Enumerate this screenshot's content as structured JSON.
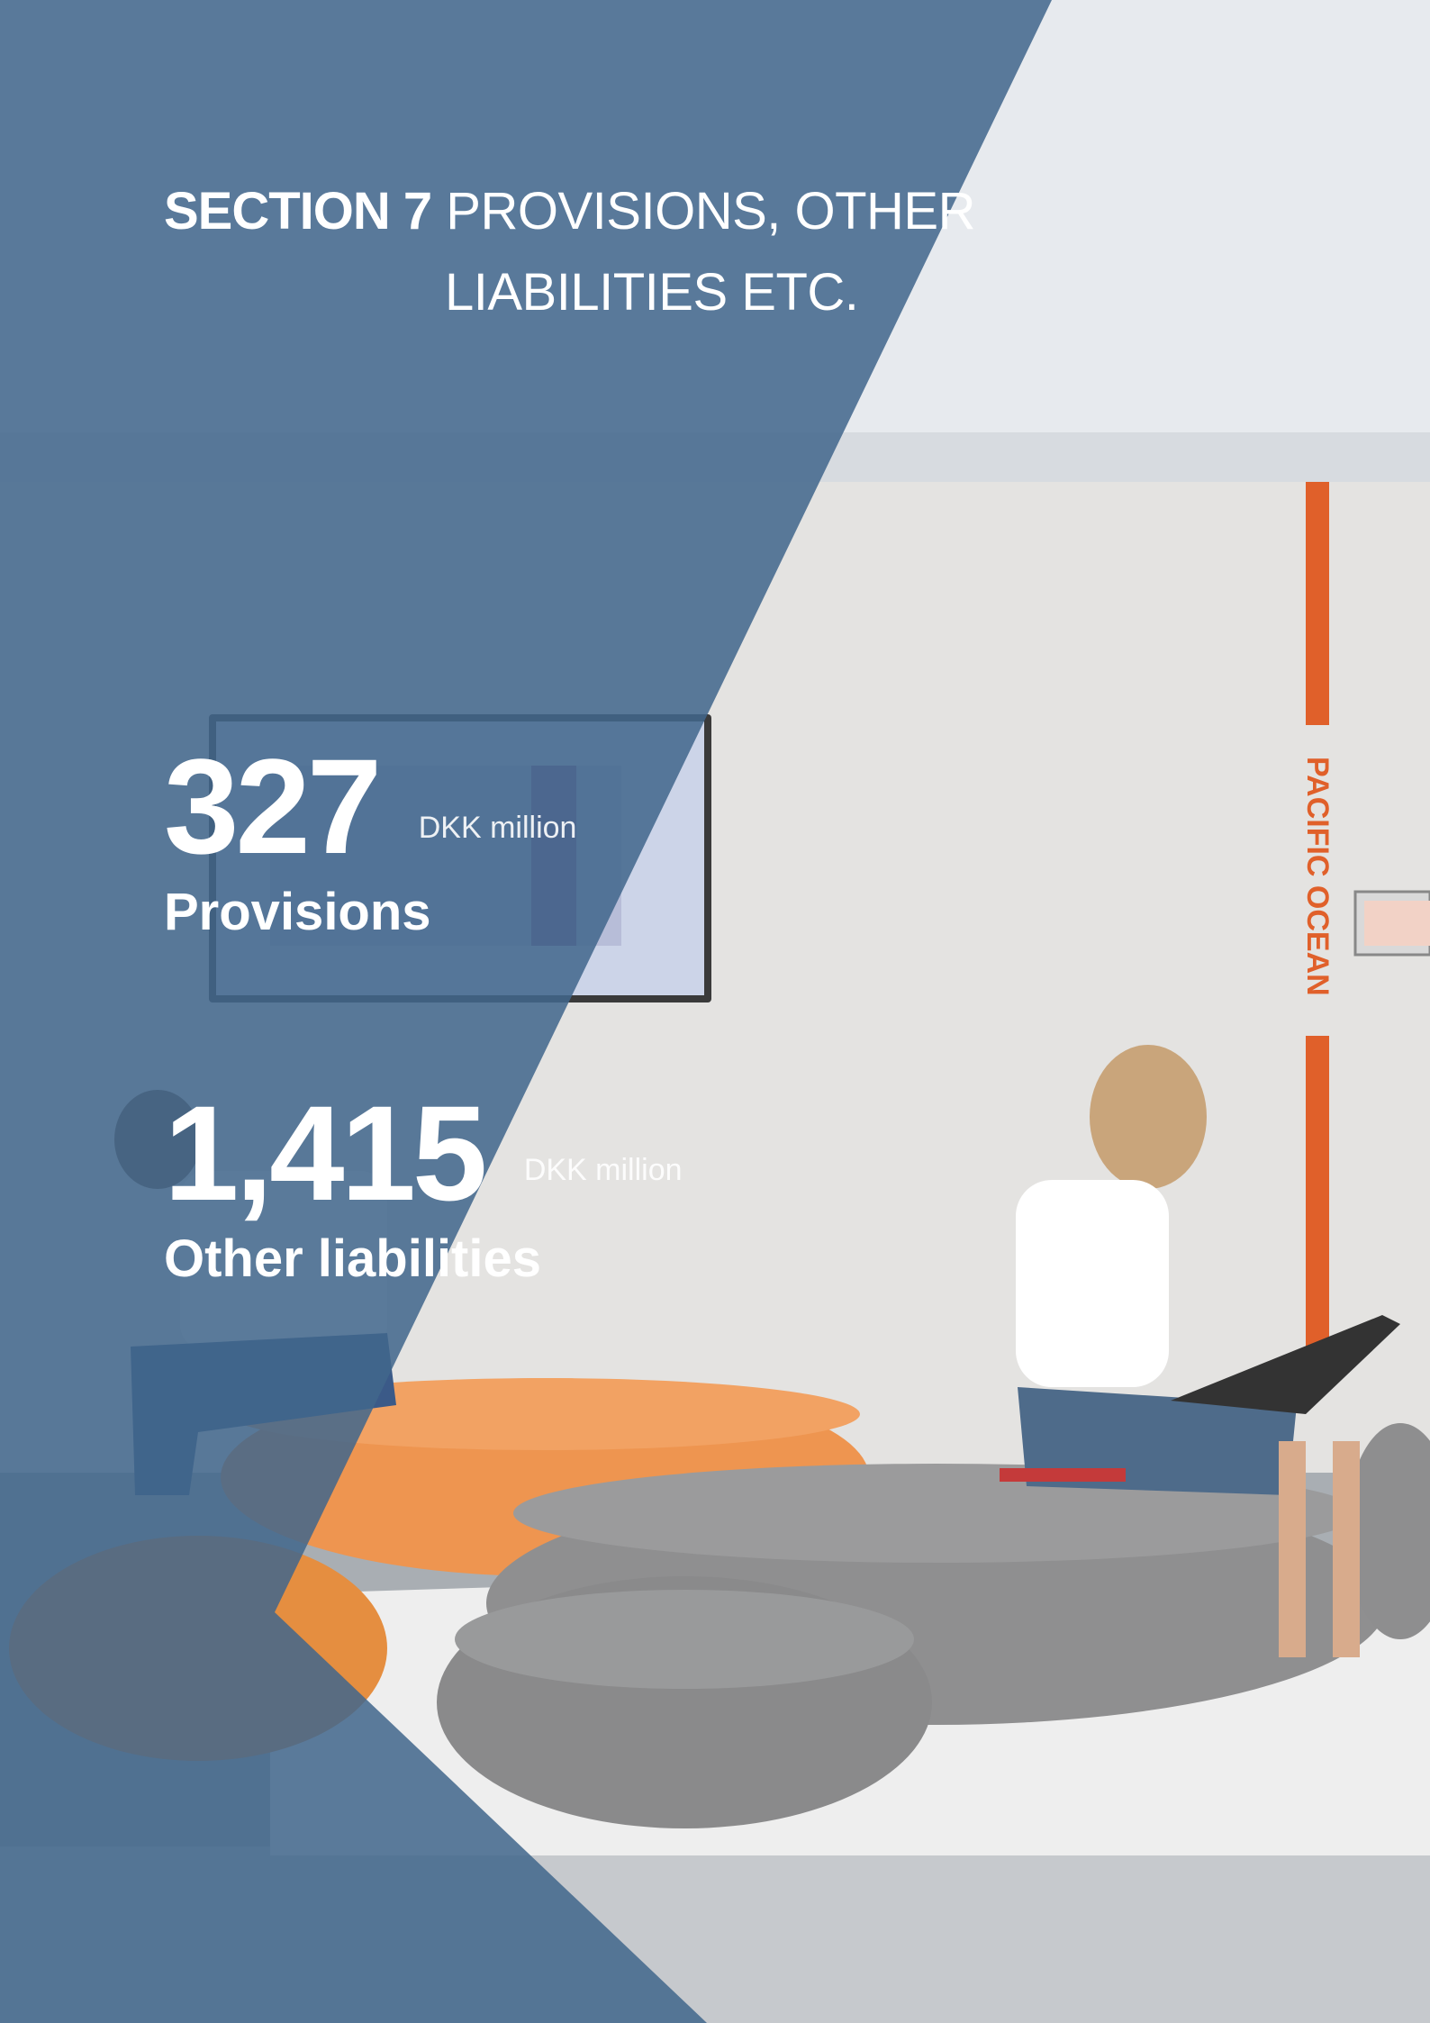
{
  "section": {
    "number_label": "SECTION 7",
    "title_line1": "PROVISIONS, OTHER",
    "title_line2": "LIABILITIES ETC."
  },
  "kpis": [
    {
      "value": "327",
      "unit": "DKK million",
      "label": "Provisions"
    },
    {
      "value": "1,415",
      "unit": "DKK million",
      "label": "Other liabilities"
    }
  ],
  "photo": {
    "wall_sign": "PACIFIC OCEAN"
  },
  "colors": {
    "overlay_blue": "#41668c",
    "accent_orange": "#e0602a",
    "text": "#ffffff"
  }
}
